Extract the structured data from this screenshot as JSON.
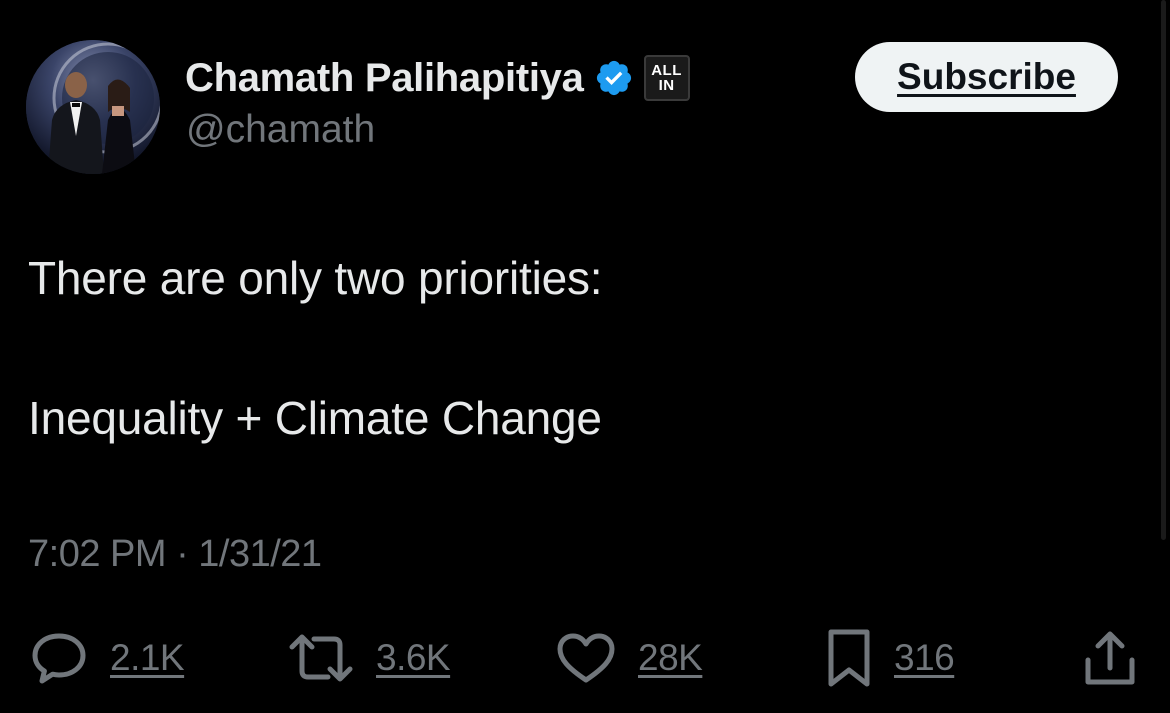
{
  "author": {
    "display_name": "Chamath Palihapitiya",
    "handle": "@chamath",
    "verified_icon": "verified-badge-icon",
    "affiliate_badge": [
      "ALL",
      "IN"
    ]
  },
  "subscribe_label": "Subscribe",
  "tweet": {
    "line1": "There are only two priorities:",
    "line2": "Inequality + Climate Change",
    "timestamp": "7:02 PM · 1/31/21"
  },
  "actions": {
    "replies": "2.1K",
    "reposts": "3.6K",
    "likes": "28K",
    "bookmarks": "316"
  },
  "colors": {
    "background": "#000000",
    "primary_text": "#e7e9ea",
    "secondary_text": "#71767b",
    "verified_blue": "#1d9bf0",
    "button_bg": "#eff3f4"
  }
}
